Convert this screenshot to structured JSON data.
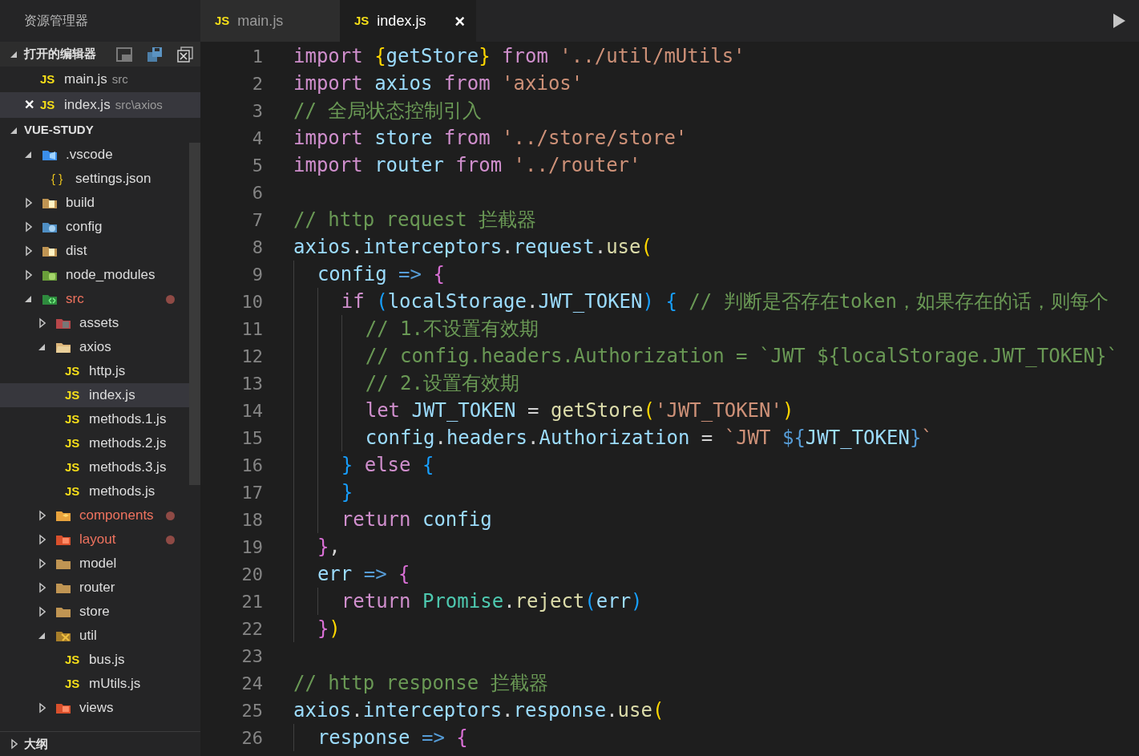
{
  "sidebar": {
    "title": "资源管理器",
    "open_editors": {
      "title": "打开的编辑器",
      "expanded": true,
      "items": [
        {
          "badge": "JS",
          "label": "main.js",
          "path": "src",
          "selected": false
        },
        {
          "close": "✕",
          "badge": "JS",
          "label": "index.js",
          "path": "src\\axios",
          "selected": true
        }
      ]
    },
    "project": {
      "title": "VUE-STUDY",
      "expanded": true,
      "tree": [
        {
          "label": ".vscode",
          "kind": "vscode",
          "expanded": true,
          "selected": false,
          "modified": false,
          "children": [
            {
              "label": "settings.json",
              "badge": "{ }",
              "kind": "json",
              "selected": false,
              "modified": false
            }
          ]
        },
        {
          "label": "build",
          "kind": "docs",
          "expanded": false,
          "selected": false,
          "modified": false
        },
        {
          "label": "config",
          "kind": "config",
          "expanded": false,
          "selected": false,
          "modified": false
        },
        {
          "label": "dist",
          "kind": "docs",
          "expanded": false,
          "selected": false,
          "modified": false
        },
        {
          "label": "node_modules",
          "kind": "node",
          "expanded": false,
          "selected": false,
          "modified": false
        },
        {
          "label": "src",
          "kind": "src",
          "expanded": true,
          "selected": false,
          "modified": true,
          "children": [
            {
              "label": "assets",
              "kind": "assets",
              "expanded": false,
              "selected": false,
              "modified": false
            },
            {
              "label": "axios",
              "kind": "open",
              "expanded": true,
              "selected": false,
              "modified": false,
              "children": [
                {
                  "label": "http.js",
                  "badge": "JS",
                  "kind": "js",
                  "selected": false,
                  "modified": false
                },
                {
                  "label": "index.js",
                  "badge": "JS",
                  "kind": "js",
                  "selected": true,
                  "modified": false
                },
                {
                  "label": "methods.1.js",
                  "badge": "JS",
                  "kind": "js",
                  "selected": false,
                  "modified": false
                },
                {
                  "label": "methods.2.js",
                  "badge": "JS",
                  "kind": "js",
                  "selected": false,
                  "modified": false
                },
                {
                  "label": "methods.3.js",
                  "badge": "JS",
                  "kind": "js",
                  "selected": false,
                  "modified": false
                },
                {
                  "label": "methods.js",
                  "badge": "JS",
                  "kind": "js",
                  "selected": false,
                  "modified": false
                }
              ]
            },
            {
              "label": "components",
              "kind": "components",
              "expanded": false,
              "selected": false,
              "modified": true
            },
            {
              "label": "layout",
              "kind": "layout",
              "expanded": false,
              "selected": false,
              "modified": true
            },
            {
              "label": "model",
              "kind": "folder",
              "expanded": false,
              "selected": false,
              "modified": false
            },
            {
              "label": "router",
              "kind": "folder",
              "expanded": false,
              "selected": false,
              "modified": false
            },
            {
              "label": "store",
              "kind": "folder",
              "expanded": false,
              "selected": false,
              "modified": false
            },
            {
              "label": "util",
              "kind": "util",
              "expanded": true,
              "selected": false,
              "modified": false,
              "children": [
                {
                  "label": "bus.js",
                  "badge": "JS",
                  "kind": "js",
                  "selected": false,
                  "modified": false
                },
                {
                  "label": "mUtils.js",
                  "badge": "JS",
                  "kind": "js",
                  "selected": false,
                  "modified": false
                }
              ]
            },
            {
              "label": "views",
              "kind": "layout",
              "expanded": false,
              "selected": false,
              "modified": false
            }
          ]
        }
      ]
    },
    "outline": {
      "title": "大纲",
      "expanded": false
    }
  },
  "tabs": [
    {
      "badge": "JS",
      "label": "main.js",
      "selected": false
    },
    {
      "badge": "JS",
      "label": "index.js",
      "selected": true,
      "close": "×"
    }
  ],
  "editor": {
    "lines": [
      {
        "number": "1",
        "tokens": [
          {
            "kind": "kw",
            "text": "import "
          },
          {
            "kind": "by",
            "text": "{"
          },
          {
            "kind": "var",
            "text": "getStore"
          },
          {
            "kind": "by",
            "text": "} "
          },
          {
            "kind": "kw",
            "text": "from "
          },
          {
            "kind": "str",
            "text": "'../util/mUtils'"
          }
        ]
      },
      {
        "number": "2",
        "tokens": [
          {
            "kind": "kw",
            "text": "import"
          },
          {
            "kind": "var",
            "text": " axios "
          },
          {
            "kind": "kw",
            "text": "from"
          },
          {
            "kind": "str",
            "text": " 'axios'"
          }
        ]
      },
      {
        "number": "3",
        "tokens": [
          {
            "kind": "cmt",
            "text": "// 全局状态控制引入"
          }
        ]
      },
      {
        "number": "4",
        "tokens": [
          {
            "kind": "kw",
            "text": "import"
          },
          {
            "kind": "var",
            "text": " store "
          },
          {
            "kind": "kw",
            "text": "from"
          },
          {
            "kind": "str",
            "text": " '../store/store'"
          }
        ]
      },
      {
        "number": "5",
        "tokens": [
          {
            "kind": "kw",
            "text": "import"
          },
          {
            "kind": "var",
            "text": " router "
          },
          {
            "kind": "kw",
            "text": "from"
          },
          {
            "kind": "str",
            "text": " '../router'"
          }
        ]
      },
      {
        "number": "6"
      },
      {
        "number": "7",
        "tokens": [
          {
            "kind": "cmt",
            "text": "// http request 拦截器"
          }
        ]
      },
      {
        "number": "8",
        "tokens": [
          {
            "kind": "var",
            "text": "axios"
          },
          {
            "kind": "p",
            "text": "."
          },
          {
            "kind": "var",
            "text": "interceptors"
          },
          {
            "kind": "p",
            "text": "."
          },
          {
            "kind": "var",
            "text": "request"
          },
          {
            "kind": "p",
            "text": "."
          },
          {
            "kind": "fn",
            "text": "use"
          },
          {
            "kind": "by",
            "text": "("
          }
        ]
      },
      {
        "number": "9",
        "tokens": [
          {
            "kind": "var",
            "text": "  config"
          },
          {
            "kind": "op",
            "text": " => "
          },
          {
            "kind": "bp",
            "text": "{"
          }
        ]
      },
      {
        "number": "10",
        "tokens": [
          {
            "kind": "kw",
            "text": "    if "
          },
          {
            "kind": "bb",
            "text": "("
          },
          {
            "kind": "var",
            "text": "localStorage"
          },
          {
            "kind": "p",
            "text": "."
          },
          {
            "kind": "var",
            "text": "JWT_TOKEN"
          },
          {
            "kind": "bb",
            "text": ") { "
          },
          {
            "kind": "cmt",
            "text": "// 判断是否存在token，如果存在的话，则每个"
          }
        ]
      },
      {
        "number": "11",
        "tokens": [
          {
            "kind": "cmt",
            "text": "      // 1.不设置有效期"
          }
        ]
      },
      {
        "number": "12",
        "tokens": [
          {
            "kind": "cmt",
            "text": "      // config.headers.Authorization = `JWT ${localStorage.JWT_TOKEN}`"
          }
        ]
      },
      {
        "number": "13",
        "tokens": [
          {
            "kind": "cmt",
            "text": "      // 2.设置有效期"
          }
        ]
      },
      {
        "number": "14",
        "tokens": [
          {
            "kind": "kw",
            "text": "      let"
          },
          {
            "kind": "var",
            "text": " JWT_TOKEN"
          },
          {
            "kind": "p",
            "text": " = "
          },
          {
            "kind": "fn",
            "text": "getStore"
          },
          {
            "kind": "by",
            "text": "("
          },
          {
            "kind": "str",
            "text": "'JWT_TOKEN'"
          },
          {
            "kind": "by",
            "text": ")"
          }
        ]
      },
      {
        "number": "15",
        "tokens": [
          {
            "kind": "var",
            "text": "      config"
          },
          {
            "kind": "p",
            "text": "."
          },
          {
            "kind": "var",
            "text": "headers"
          },
          {
            "kind": "p",
            "text": "."
          },
          {
            "kind": "var",
            "text": "Authorization"
          },
          {
            "kind": "p",
            "text": " = "
          },
          {
            "kind": "str",
            "text": "`JWT "
          },
          {
            "kind": "tpl",
            "text": "${"
          },
          {
            "kind": "var",
            "text": "JWT_TOKEN"
          },
          {
            "kind": "tpl",
            "text": "}"
          },
          {
            "kind": "str",
            "text": "`"
          }
        ]
      },
      {
        "number": "16",
        "tokens": [
          {
            "kind": "bb",
            "text": "    } "
          },
          {
            "kind": "kw",
            "text": "else "
          },
          {
            "kind": "bb",
            "text": "{"
          }
        ]
      },
      {
        "number": "17",
        "tokens": [
          {
            "kind": "bb",
            "text": "    }"
          }
        ]
      },
      {
        "number": "18",
        "tokens": [
          {
            "kind": "kw",
            "text": "    return"
          },
          {
            "kind": "var",
            "text": " config"
          }
        ]
      },
      {
        "number": "19",
        "tokens": [
          {
            "kind": "bp",
            "text": "  }"
          },
          {
            "kind": "p",
            "text": ","
          }
        ]
      },
      {
        "number": "20",
        "tokens": [
          {
            "kind": "var",
            "text": "  err"
          },
          {
            "kind": "op",
            "text": " => "
          },
          {
            "kind": "bp",
            "text": "{"
          }
        ]
      },
      {
        "number": "21",
        "tokens": [
          {
            "kind": "kw",
            "text": "    return "
          },
          {
            "kind": "type",
            "text": "Promise"
          },
          {
            "kind": "p",
            "text": "."
          },
          {
            "kind": "fn",
            "text": "reject"
          },
          {
            "kind": "bb",
            "text": "("
          },
          {
            "kind": "var",
            "text": "err"
          },
          {
            "kind": "bb",
            "text": ")"
          }
        ]
      },
      {
        "number": "22",
        "tokens": [
          {
            "kind": "bp",
            "text": "  }"
          },
          {
            "kind": "by",
            "text": ")"
          }
        ]
      },
      {
        "number": "23"
      },
      {
        "number": "24",
        "tokens": [
          {
            "kind": "cmt",
            "text": "// http response 拦截器"
          }
        ]
      },
      {
        "number": "25",
        "tokens": [
          {
            "kind": "var",
            "text": "axios"
          },
          {
            "kind": "p",
            "text": "."
          },
          {
            "kind": "var",
            "text": "interceptors"
          },
          {
            "kind": "p",
            "text": "."
          },
          {
            "kind": "var",
            "text": "response"
          },
          {
            "kind": "p",
            "text": "."
          },
          {
            "kind": "fn",
            "text": "use"
          },
          {
            "kind": "by",
            "text": "("
          }
        ]
      },
      {
        "number": "26",
        "tokens": [
          {
            "kind": "var",
            "text": "  response"
          },
          {
            "kind": "op",
            "text": " => "
          },
          {
            "kind": "bp",
            "text": "{"
          }
        ]
      }
    ]
  }
}
